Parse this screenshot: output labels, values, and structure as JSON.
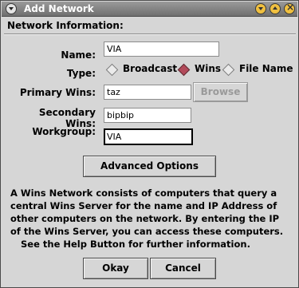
{
  "window": {
    "title": "Add Network",
    "menu_icon": "window-menu-icon",
    "controls": [
      "minimize-icon",
      "maximize-icon",
      "close-icon"
    ]
  },
  "section": {
    "title": "Network Information:"
  },
  "form": {
    "name_label": "Name:",
    "name_value": "VIA",
    "type_label": "Type:",
    "type_options": [
      "Broadcast",
      "Wins",
      "File Name"
    ],
    "type_selected": "Wins",
    "primary_label": "Primary Wins:",
    "primary_value": "taz",
    "browse_label": "Browse",
    "secondary_label": "Secondary Wins:",
    "secondary_value": "bipbip",
    "workgroup_label": "Workgroup:",
    "workgroup_value": "VIA"
  },
  "advanced_label": "Advanced Options",
  "info_lines": [
    "A Wins Network consists of computers that query a",
    "central Wins Server for the name and IP Address of",
    "other computers on the network. By entering the IP",
    "of the Wins Server, you can access these computers.",
    "See the Help Button for further information."
  ],
  "buttons": {
    "okay": "Okay",
    "cancel": "Cancel"
  },
  "colors": {
    "selected_radio": "#b24a5a",
    "titlebar": "#7f7f7f",
    "dialog_bg": "#d6d6d6"
  }
}
